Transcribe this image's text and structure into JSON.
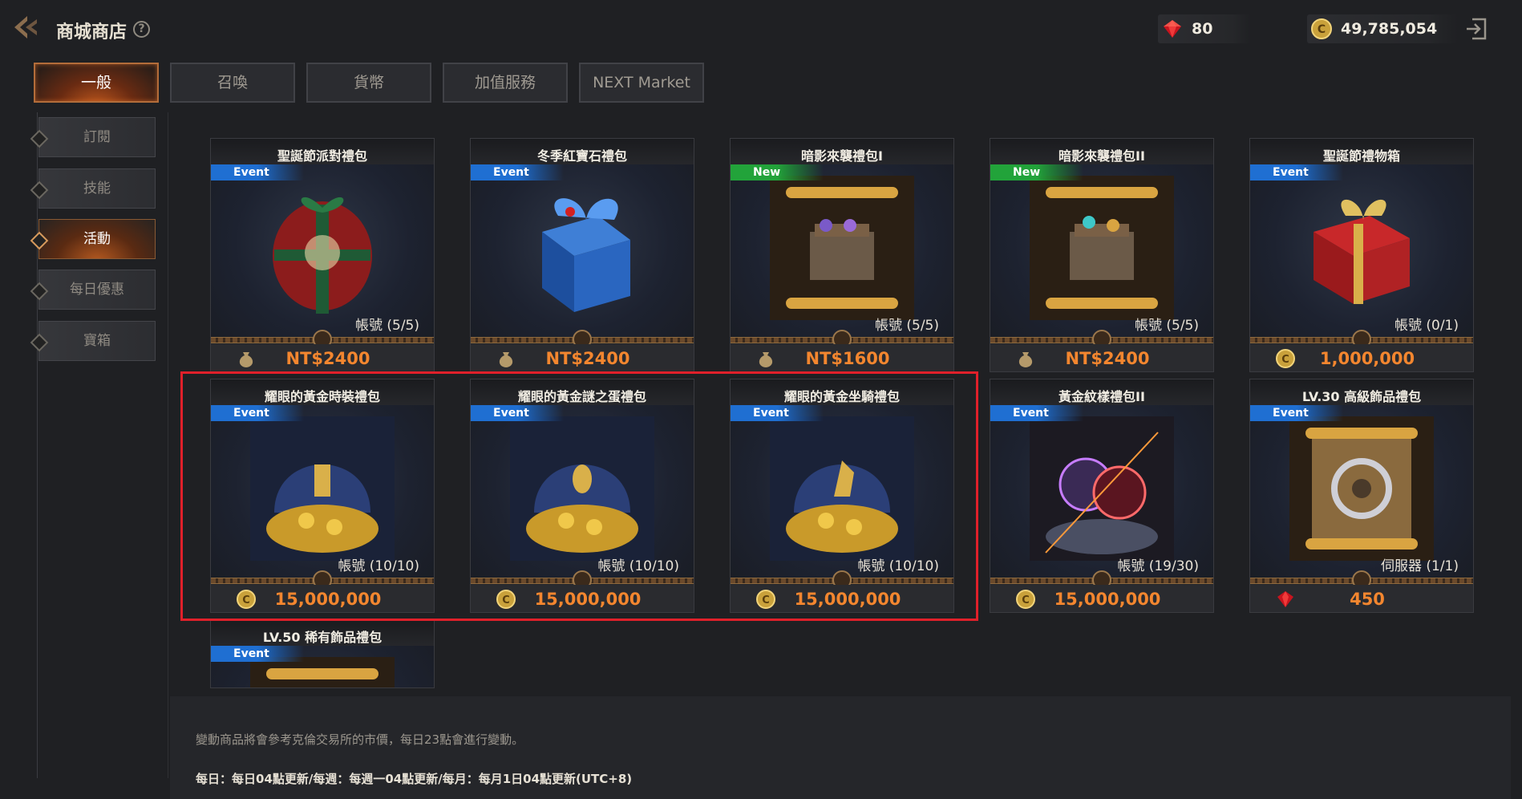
{
  "header": {
    "title": "商城商店",
    "help_icon": "question-mark-icon",
    "gems": "80",
    "gold": "49,785,054"
  },
  "tabs": [
    {
      "label": "一般",
      "active": true
    },
    {
      "label": "召喚",
      "active": false
    },
    {
      "label": "貨幣",
      "active": false
    },
    {
      "label": "加值服務",
      "active": false
    },
    {
      "label": "NEXT Market",
      "active": false
    }
  ],
  "sidebar": {
    "items": [
      {
        "label": "訂閱",
        "active": false
      },
      {
        "label": "技能",
        "active": false
      },
      {
        "label": "活動",
        "active": true
      },
      {
        "label": "每日優惠",
        "active": false
      },
      {
        "label": "寶箱",
        "active": false
      }
    ]
  },
  "products": [
    {
      "title": "聖誕節派對禮包",
      "badge": "Event",
      "limit": "帳號 (5/5)",
      "price": "NT$2400",
      "currency": "cash"
    },
    {
      "title": "冬季紅寶石禮包",
      "badge": "Event",
      "limit": "",
      "price": "NT$2400",
      "currency": "cash"
    },
    {
      "title": "暗影來襲禮包I",
      "badge": "New",
      "limit": "帳號 (5/5)",
      "price": "NT$1600",
      "currency": "cash"
    },
    {
      "title": "暗影來襲禮包II",
      "badge": "New",
      "limit": "帳號 (5/5)",
      "price": "NT$2400",
      "currency": "cash"
    },
    {
      "title": "聖誕節禮物箱",
      "badge": "Event",
      "limit": "帳號 (0/1)",
      "price": "1,000,000",
      "currency": "gold"
    },
    {
      "title": "耀眼的黃金時裝禮包",
      "badge": "Event",
      "limit": "帳號 (10/10)",
      "price": "15,000,000",
      "currency": "gold"
    },
    {
      "title": "耀眼的黃金謎之蛋禮包",
      "badge": "Event",
      "limit": "帳號 (10/10)",
      "price": "15,000,000",
      "currency": "gold"
    },
    {
      "title": "耀眼的黃金坐騎禮包",
      "badge": "Event",
      "limit": "帳號 (10/10)",
      "price": "15,000,000",
      "currency": "gold"
    },
    {
      "title": "黃金紋樣禮包II",
      "badge": "Event",
      "limit": "帳號 (19/30)",
      "price": "15,000,000",
      "currency": "gold"
    },
    {
      "title": "LV.30 高級飾品禮包",
      "badge": "Event",
      "limit": "伺服器 (1/1)",
      "price": "450",
      "currency": "gem"
    },
    {
      "title": "LV.50 稀有飾品禮包",
      "badge": "Event",
      "limit": "",
      "price": "",
      "currency": ""
    }
  ],
  "footer": {
    "note1": "變動商品將會參考克倫交易所的市價，每日23點會進行變動。",
    "note2": "每日：每日04點更新/每週：每週一04點更新/每月：每月1日04點更新(UTC+8)"
  },
  "colors": {
    "accent_orange": "#f3862f",
    "event_badge": "#1f6fd2",
    "new_badge": "#22a33a",
    "highlight": "#e0202a"
  }
}
